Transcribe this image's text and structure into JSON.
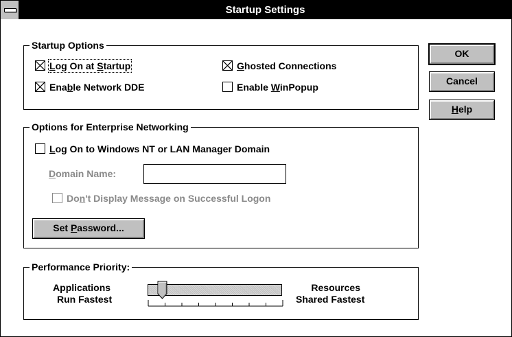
{
  "window": {
    "title": "Startup Settings"
  },
  "startup_options": {
    "legend": "Startup Options",
    "logon_at_startup": {
      "label": "Log On at Startup",
      "checked": true
    },
    "ghosted_connections": {
      "label": "Ghosted Connections",
      "checked": true
    },
    "enable_network_dde": {
      "label": "Enable Network DDE",
      "checked": true
    },
    "enable_winpopup": {
      "label": "Enable WinPopup",
      "checked": false
    }
  },
  "enterprise": {
    "legend": "Options for Enterprise Networking",
    "logon_domain": {
      "label": "Log On to Windows NT or LAN Manager Domain",
      "checked": false
    },
    "domain_name_label": "Domain Name:",
    "domain_name_value": "",
    "dont_display": {
      "label": "Don't Display Message on Successful Logon",
      "checked": false
    },
    "set_password_label": "Set Password..."
  },
  "performance": {
    "legend": "Performance Priority:",
    "left_label_1": "Applications",
    "left_label_2": "Run Fastest",
    "right_label_1": "Resources",
    "right_label_2": "Shared Fastest",
    "slider_value": 0.12
  },
  "buttons": {
    "ok": "OK",
    "cancel": "Cancel",
    "help": "Help"
  }
}
